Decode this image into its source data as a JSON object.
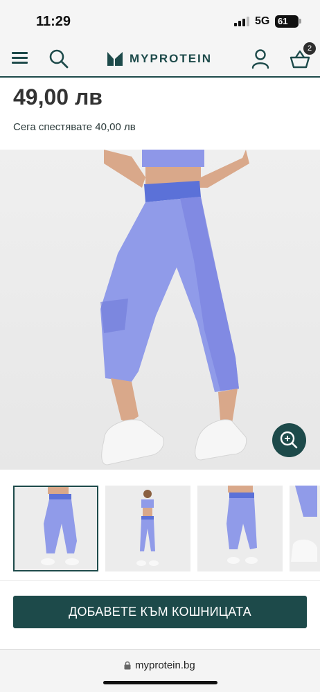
{
  "status_bar": {
    "time": "11:29",
    "network": "5G",
    "battery": "61"
  },
  "header": {
    "brand": "MYPROTEIN",
    "basket_count": "2",
    "brand_color": "#1d4a4a"
  },
  "product": {
    "price": "49,00 лв",
    "savings": "Сега спестявате 40,00 лв"
  },
  "gallery": {
    "thumbnail_count": 4,
    "active_index": 0
  },
  "cta": {
    "label": "ДОБАВЕТЕ КЪМ КОШНИЦАТА"
  },
  "browser": {
    "url": "myprotein.bg"
  }
}
